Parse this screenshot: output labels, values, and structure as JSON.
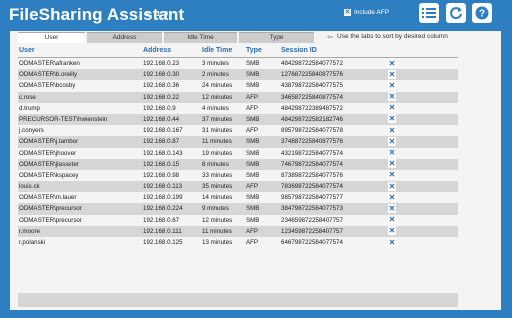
{
  "header": {
    "title": "FileSharing Assistant",
    "version": "v. 1.0",
    "afp_label": "Include AFP",
    "afp_checked": "✕"
  },
  "tabs": [
    "User",
    "Address",
    "Idle Time",
    "Type"
  ],
  "tab_hint": "Use the tabs to sort by desired column",
  "columns": {
    "user": "User",
    "address": "Address",
    "idle": "Idle Time",
    "type": "Type",
    "session": "Session ID"
  },
  "rows": [
    {
      "user": "ODMASTER\\afranken",
      "address": "192.168.0.23",
      "idle": "3 minutes",
      "type": "SMB",
      "session": "484298722584077572"
    },
    {
      "user": "ODMASTER\\b.oreilly",
      "address": "192.168.0.30",
      "idle": "2 minutes",
      "type": "SMB",
      "session": "127687225840877576"
    },
    {
      "user": "ODMASTER\\bcosby",
      "address": "192.168.0.36",
      "idle": "24 minutes",
      "type": "SMB",
      "session": "438798722584077575"
    },
    {
      "user": "c.rose",
      "address": "192.168.0.22",
      "idle": "12 minutes",
      "type": "AFP",
      "session": "346587225840877574"
    },
    {
      "user": "d.trump",
      "address": "192.168.0.9",
      "idle": "4 minutes",
      "type": "AFP",
      "session": "484298722389487572"
    },
    {
      "user": "PRECURSOR-TEST\\hwienstein",
      "address": "192.168.0.44",
      "idle": "37 minutes",
      "type": "SMB",
      "session": "484298722582182746"
    },
    {
      "user": "j.conyers",
      "address": "192.168.0.167",
      "idle": "31 minutes",
      "type": "AFP",
      "session": "895798722584077578"
    },
    {
      "user": "ODMASTER\\j.tambor",
      "address": "192.168.0.87",
      "idle": "11 minutes",
      "type": "SMB",
      "session": "374887225840877576"
    },
    {
      "user": "ODMASTER\\jhoover",
      "address": "192.168.0.143",
      "idle": "19 minutes",
      "type": "SMB",
      "session": "432198722584077574"
    },
    {
      "user": "ODMASTER\\jlasseter",
      "address": "192.168.0.15",
      "idle": "8 minutes",
      "type": "SMB",
      "session": "746798722584077574"
    },
    {
      "user": "ODMASTER\\kspacey",
      "address": "192.168.0.98",
      "idle": "33 minutes",
      "type": "SMB",
      "session": "873898722584077576"
    },
    {
      "user": "louis.ck",
      "address": "192.168.0.113",
      "idle": "35 minutes",
      "type": "AFP",
      "session": "783698722584077574"
    },
    {
      "user": "ODMASTER\\m.lauer",
      "address": "192.168.0.199",
      "idle": "14 minutes",
      "type": "SMB",
      "session": "985798722584077577"
    },
    {
      "user": "ODMASTER\\precursor",
      "address": "192.168.0.224",
      "idle": "9 minutes",
      "type": "SMB",
      "session": "384798722584077573"
    },
    {
      "user": "ODMASTER\\precursor",
      "address": "192.168.0.67",
      "idle": "12 minutes",
      "type": "SMB",
      "session": "234659872258407757"
    },
    {
      "user": "r.moore",
      "address": "192.168.0.111",
      "idle": "11 minutes",
      "type": "AFP",
      "session": "123459872258407757"
    },
    {
      "user": "r.polanski",
      "address": "192.168.0.125",
      "idle": "13 minutes",
      "type": "AFP",
      "session": "646798722584077574"
    }
  ],
  "delete_glyph": "✕",
  "colors": {
    "brand": "#2d7fc1",
    "accent": "#2b6cb0",
    "row_alt": "#d6d6d6"
  }
}
